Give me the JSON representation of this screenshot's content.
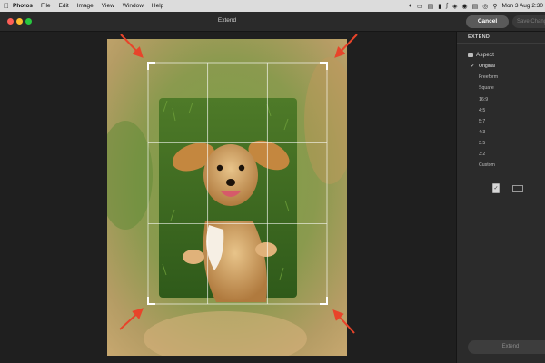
{
  "menubar": {
    "app": "Photos",
    "menus": [
      "File",
      "Edit",
      "Image",
      "View",
      "Window",
      "Help"
    ],
    "datetime": "Mon 3 Aug  2:30"
  },
  "window": {
    "title": "Extend",
    "cancel_label": "Cancel",
    "save_label": "Save Changes"
  },
  "panel": {
    "tab": "EXTEND",
    "section": "Aspect",
    "options": [
      "Original",
      "Freeform",
      "Square",
      "16:9",
      "4:5",
      "5:7",
      "4:3",
      "3:5",
      "3:2",
      "Custom"
    ],
    "selected": "Original",
    "extend_button": "Extend"
  }
}
